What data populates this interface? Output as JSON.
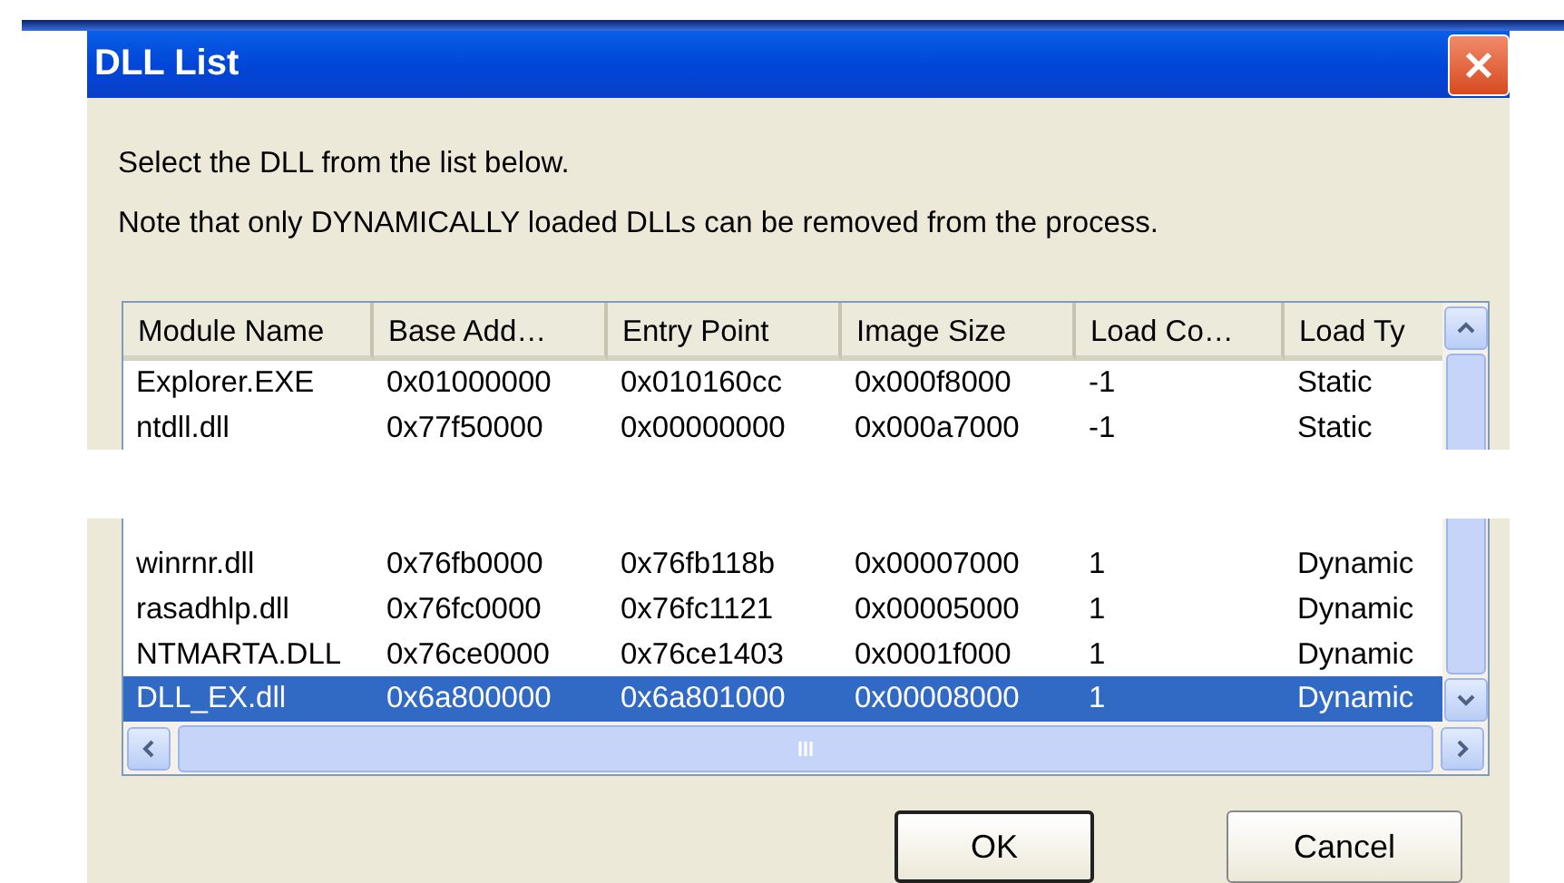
{
  "window": {
    "title": "DLL List"
  },
  "instructions": [
    "Select the DLL from the list below.",
    "Note that only DYNAMICALLY loaded DLLs can be removed from the process."
  ],
  "table": {
    "columns": [
      "Module Name",
      "Base Add…",
      "Entry Point",
      "Image Size",
      "Load Co…",
      "Load Ty"
    ],
    "rows": [
      {
        "cells": [
          "Explorer.EXE",
          "0x01000000",
          "0x010160cc",
          "0x000f8000",
          "-1",
          "Static"
        ],
        "selected": false
      },
      {
        "cells": [
          "ntdll.dll",
          "0x77f50000",
          "0x00000000",
          "0x000a7000",
          "-1",
          "Static"
        ],
        "selected": false
      },
      {
        "kind": "gap"
      },
      {
        "cells": [
          "winrnr.dll",
          "0x76fb0000",
          "0x76fb118b",
          "0x00007000",
          "1",
          "Dynamic"
        ],
        "selected": false
      },
      {
        "cells": [
          "rasadhlp.dll",
          "0x76fc0000",
          "0x76fc1121",
          "0x00005000",
          "1",
          "Dynamic"
        ],
        "selected": false
      },
      {
        "cells": [
          "NTMARTA.DLL",
          "0x76ce0000",
          "0x76ce1403",
          "0x0001f000",
          "1",
          "Dynamic"
        ],
        "selected": false
      },
      {
        "cells": [
          "DLL_EX.dll",
          "0x6a800000",
          "0x6a801000",
          "0x00008000",
          "1",
          "Dynamic"
        ],
        "selected": true
      }
    ]
  },
  "buttons": [
    "OK",
    "Cancel"
  ]
}
